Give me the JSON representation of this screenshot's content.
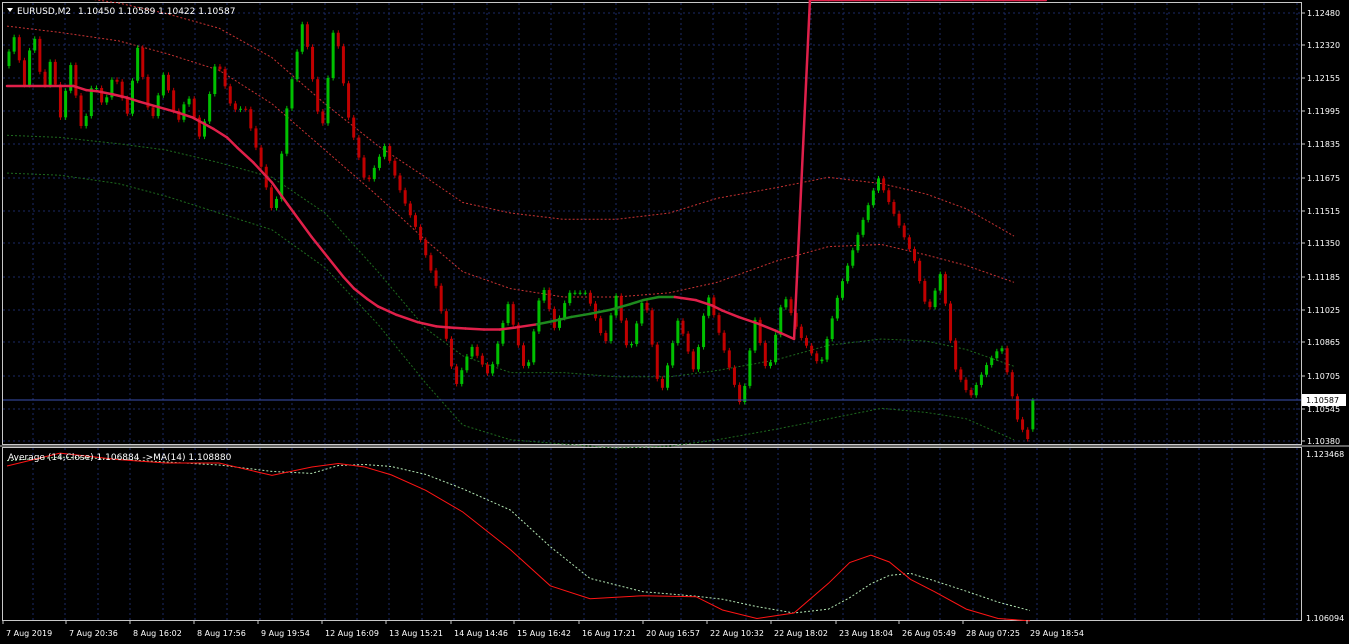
{
  "main_panel": {
    "symbol_label": "EURUSD,M2",
    "ohlc_label": "1.10450 1.10589 1.10422 1.10587",
    "current_price_label": "1.10587",
    "price_ticks": [
      "1.12480",
      "1.12320",
      "1.12155",
      "1.11995",
      "1.11835",
      "1.11675",
      "1.11515",
      "1.11350",
      "1.11185",
      "1.11025",
      "1.10865",
      "1.10705",
      "1.10545",
      "1.10380"
    ]
  },
  "indicator_panel": {
    "title": "Average (14,Close) 1.106884 ->MA(14) 1.108880",
    "top_label": "1.123468",
    "bottom_label": "1.106094"
  },
  "time_axis": {
    "labels": [
      "7 Aug 2019",
      "7 Aug 20:36",
      "8 Aug 16:02",
      "8 Aug 17:56",
      "9 Aug 19:54",
      "12 Aug 16:09",
      "13 Aug 15:21",
      "14 Aug 14:46",
      "15 Aug 16:42",
      "16 Aug 17:21",
      "20 Aug 16:57",
      "22 Aug 10:32",
      "22 Aug 18:02",
      "23 Aug 18:04",
      "26 Aug 05:49",
      "28 Aug 07:25",
      "29 Aug 18:54"
    ]
  },
  "colors": {
    "background": "#000000",
    "grid": "#1c2a66",
    "axis": "#c8c8c8",
    "bull_candle": "#00c000",
    "bear_candle": "#c00000",
    "ma_down": "#e0204a",
    "ma_up": "#1e8a1e",
    "upper_band": "#c83232",
    "lower_band": "#1e6a1e",
    "avg_line": "#ff1414",
    "ma14_line": "#b4e6b4"
  },
  "chart_data": {
    "type": "candlestick",
    "bars": 200,
    "ohlc_last": {
      "open": 1.1045,
      "high": 1.10589,
      "low": 1.10422,
      "close": 1.10587
    },
    "price_range": [
      1.1038,
      1.1248
    ],
    "close_path_anchors": [
      [
        0,
        1.1218
      ],
      [
        4,
        1.1232
      ],
      [
        8,
        1.1208
      ],
      [
        11,
        1.1237
      ],
      [
        15,
        1.1205
      ],
      [
        18,
        1.1222
      ],
      [
        22,
        1.119
      ],
      [
        25,
        1.1222
      ],
      [
        30,
        1.1185
      ],
      [
        34,
        1.1212
      ],
      [
        38,
        1.1198
      ],
      [
        42,
        1.1215
      ],
      [
        47,
        1.1195
      ],
      [
        51,
        1.1227
      ],
      [
        56,
        1.119
      ],
      [
        61,
        1.1215
      ],
      [
        66,
        1.119
      ],
      [
        70,
        1.1205
      ],
      [
        75,
        1.1182
      ],
      [
        81,
        1.1222
      ],
      [
        87,
        1.1197
      ],
      [
        92,
        1.1198
      ],
      [
        98,
        1.117
      ],
      [
        103,
        1.1145
      ],
      [
        108,
        1.12
      ],
      [
        114,
        1.124
      ],
      [
        121,
        1.1185
      ],
      [
        126,
        1.124
      ],
      [
        131,
        1.1195
      ],
      [
        138,
        1.1161
      ],
      [
        145,
        1.118
      ],
      [
        152,
        1.1155
      ],
      [
        158,
        1.1138
      ],
      [
        165,
        1.1112
      ],
      [
        172,
        1.1065
      ],
      [
        178,
        1.1085
      ],
      [
        185,
        1.107
      ],
      [
        192,
        1.1105
      ],
      [
        199,
        1.107
      ],
      [
        205,
        1.1115
      ],
      [
        210,
        1.1092
      ],
      [
        215,
        1.111
      ],
      [
        222,
        1.111
      ],
      [
        229,
        1.1085
      ],
      [
        233,
        1.111
      ],
      [
        238,
        1.108
      ],
      [
        244,
        1.111
      ],
      [
        250,
        1.106
      ],
      [
        257,
        1.1098
      ],
      [
        263,
        1.1072
      ],
      [
        268,
        1.111
      ],
      [
        275,
        1.108
      ],
      [
        281,
        1.1055
      ],
      [
        286,
        1.1098
      ],
      [
        291,
        1.107
      ],
      [
        297,
        1.111
      ],
      [
        303,
        1.109
      ],
      [
        311,
        1.1075
      ],
      [
        318,
        1.111
      ],
      [
        326,
        1.114
      ],
      [
        333,
        1.1165
      ],
      [
        340,
        1.1145
      ],
      [
        347,
        1.1125
      ],
      [
        352,
        1.11
      ],
      [
        357,
        1.112
      ],
      [
        362,
        1.1075
      ],
      [
        368,
        1.106
      ],
      [
        374,
        1.1075
      ],
      [
        380,
        1.1085
      ],
      [
        386,
        1.105
      ],
      [
        390,
        1.104
      ],
      [
        392,
        1.10587
      ]
    ],
    "ma_line": {
      "x": [
        0,
        10,
        20,
        25,
        30,
        34,
        40,
        45,
        50,
        57,
        64,
        70,
        78,
        83,
        87,
        93,
        100,
        106,
        115,
        121,
        127,
        131,
        136,
        140,
        147,
        155,
        162,
        167,
        173,
        180,
        186,
        192,
        200,
        206,
        213,
        220,
        228,
        235,
        240,
        246,
        252,
        260,
        266,
        270,
        276,
        283,
        290,
        297,
        303,
        310,
        315,
        322,
        327,
        334,
        341,
        348,
        354,
        360,
        364,
        370,
        376,
        382,
        392
      ],
      "y": [
        1.12085,
        1.12085,
        1.12085,
        1.12085,
        1.12065,
        1.1206,
        1.12045,
        1.1203,
        1.1201,
        1.11985,
        1.1196,
        1.11935,
        1.1188,
        1.1184,
        1.1179,
        1.1172,
        1.11625,
        1.1152,
        1.11365,
        1.1127,
        1.11175,
        1.1112,
        1.1107,
        1.11035,
        1.10995,
        1.1096,
        1.1094,
        1.10935,
        1.1093,
        1.10925,
        1.10925,
        1.10935,
        1.1095,
        1.10965,
        1.10985,
        1.11,
        1.1102,
        1.11045,
        1.11065,
        1.1108,
        1.1108,
        1.11065,
        1.1104,
        1.11015,
        1.10985,
        1.10955,
        1.1092,
        1.1088
      ]
    },
    "upper_band_outer": {
      "x": [
        0,
        20,
        42,
        60,
        80,
        100,
        120,
        140,
        158,
        172,
        190,
        210,
        230,
        250,
        268,
        290,
        310,
        330,
        347,
        362,
        380
      ],
      "y": [
        1.1255,
        1.1252,
        1.1248,
        1.1243,
        1.1236,
        1.1222,
        1.12,
        1.118,
        1.1165,
        1.1153,
        1.1148,
        1.1145,
        1.1145,
        1.1148,
        1.1155,
        1.116,
        1.1165,
        1.1162,
        1.1157,
        1.115,
        1.1137
      ]
    },
    "upper_band_inner": {
      "x": [
        0,
        20,
        42,
        60,
        80,
        100,
        120,
        140,
        158,
        172,
        190,
        210,
        230,
        250,
        268,
        290,
        310,
        330,
        347,
        362,
        380
      ],
      "y": [
        1.1237,
        1.1234,
        1.123,
        1.1224,
        1.1216,
        1.12,
        1.1178,
        1.1156,
        1.1135,
        1.112,
        1.1112,
        1.1108,
        1.1108,
        1.111,
        1.1115,
        1.1125,
        1.1132,
        1.1133,
        1.1128,
        1.1123,
        1.1115
      ]
    },
    "lower_band_inner": {
      "x": [
        0,
        20,
        42,
        60,
        80,
        100,
        120,
        140,
        158,
        172,
        190,
        210,
        230,
        250,
        268,
        290,
        310,
        330,
        347,
        362,
        380
      ],
      "y": [
        1.1185,
        1.1184,
        1.1181,
        1.1178,
        1.1172,
        1.1165,
        1.1148,
        1.112,
        1.1093,
        1.108,
        1.1072,
        1.1072,
        1.107,
        1.107,
        1.1073,
        1.1078,
        1.1085,
        1.1088,
        1.1087,
        1.1083,
        1.1075
      ]
    },
    "lower_band_outer": {
      "x": [
        0,
        20,
        42,
        60,
        80,
        100,
        120,
        140,
        158,
        172,
        190,
        210,
        230,
        250,
        268,
        290,
        310,
        330,
        347,
        362,
        380
      ],
      "y": [
        1.1167,
        1.1166,
        1.1162,
        1.1156,
        1.1148,
        1.114,
        1.1122,
        1.1095,
        1.1067,
        1.1047,
        1.104,
        1.1038,
        1.1036,
        1.1037,
        1.104,
        1.1045,
        1.105,
        1.1055,
        1.1053,
        1.105,
        1.104
      ]
    },
    "indicator_range": [
      1.106094,
      1.123468
    ],
    "avg_line": {
      "x": [
        0,
        20,
        42,
        60,
        80,
        100,
        115,
        125,
        135,
        145,
        158,
        172,
        190,
        205,
        220,
        240,
        260,
        270,
        283,
        297,
        310,
        318,
        326,
        333,
        341,
        350,
        362,
        374,
        386
      ],
      "y": [
        1.12165,
        1.12295,
        1.1223,
        1.12195,
        1.12195,
        1.1207,
        1.12155,
        1.1219,
        1.12155,
        1.12075,
        1.1192,
        1.117,
        1.1132,
        1.10955,
        1.10825,
        1.10855,
        1.10845,
        1.1071,
        1.10625,
        1.1068,
        1.1098,
        1.1119,
        1.11265,
        1.11195,
        1.1102,
        1.10895,
        1.1072,
        1.10625,
        1.106
      ]
    },
    "ma14_line": {
      "x": [
        0,
        20,
        42,
        60,
        80,
        100,
        115,
        125,
        135,
        145,
        158,
        172,
        190,
        205,
        220,
        240,
        260,
        270,
        283,
        297,
        310,
        318,
        326,
        333,
        341,
        350,
        362,
        374,
        386
      ],
      "y": [
        1.1222,
        1.12255,
        1.12235,
        1.12205,
        1.12175,
        1.1211,
        1.1209,
        1.1217,
        1.1218,
        1.1216,
        1.1208,
        1.11935,
        1.1172,
        1.1135,
        1.1103,
        1.10895,
        1.1085,
        1.1082,
        1.10745,
        1.1068,
        1.1072,
        1.10835,
        1.10975,
        1.1106,
        1.1108,
        1.11005,
        1.109,
        1.1079,
        1.10705
      ]
    }
  }
}
